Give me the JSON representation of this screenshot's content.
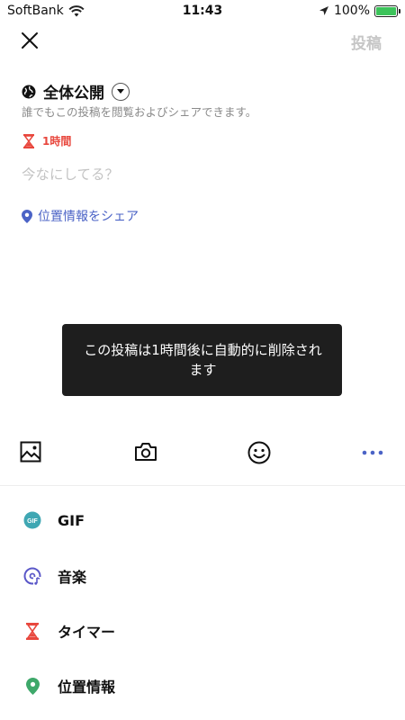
{
  "status_bar": {
    "carrier": "SoftBank",
    "time": "11:43",
    "battery": "100%",
    "icons": [
      "wifi-icon",
      "location-arrow-icon",
      "battery-charging-icon"
    ]
  },
  "header": {
    "close_icon": "close-icon",
    "post_label": "投稿"
  },
  "audience": {
    "title": "全体公開",
    "description": "誰でもこの投稿を閲覧およびシェアできます。",
    "icon": "globe-icon"
  },
  "timer": {
    "label": "1時間",
    "icon": "hourglass-icon"
  },
  "composer": {
    "placeholder": "今なにしてる？"
  },
  "location": {
    "label": "位置情報をシェア",
    "icon": "location-pin-icon"
  },
  "toast": {
    "message": "この投稿は1時間後に自動的に削除されます"
  },
  "toolbar": {
    "icons": [
      "image-icon",
      "camera-icon",
      "smiley-icon",
      "more-icon"
    ]
  },
  "menu": [
    {
      "label": "GIF",
      "icon": "gif-icon",
      "color": "#3fa7b3"
    },
    {
      "label": "音楽",
      "icon": "music-icon",
      "color": "#5a57c8"
    },
    {
      "label": "タイマー",
      "icon": "hourglass-icon",
      "color": "#e8473d"
    },
    {
      "label": "位置情報",
      "icon": "location-pin-icon",
      "color": "#3ea86a"
    }
  ],
  "colors": {
    "accent_blue": "#4b63c6",
    "timer_red": "#e8473d",
    "disabled_gray": "#c6c6c6"
  }
}
